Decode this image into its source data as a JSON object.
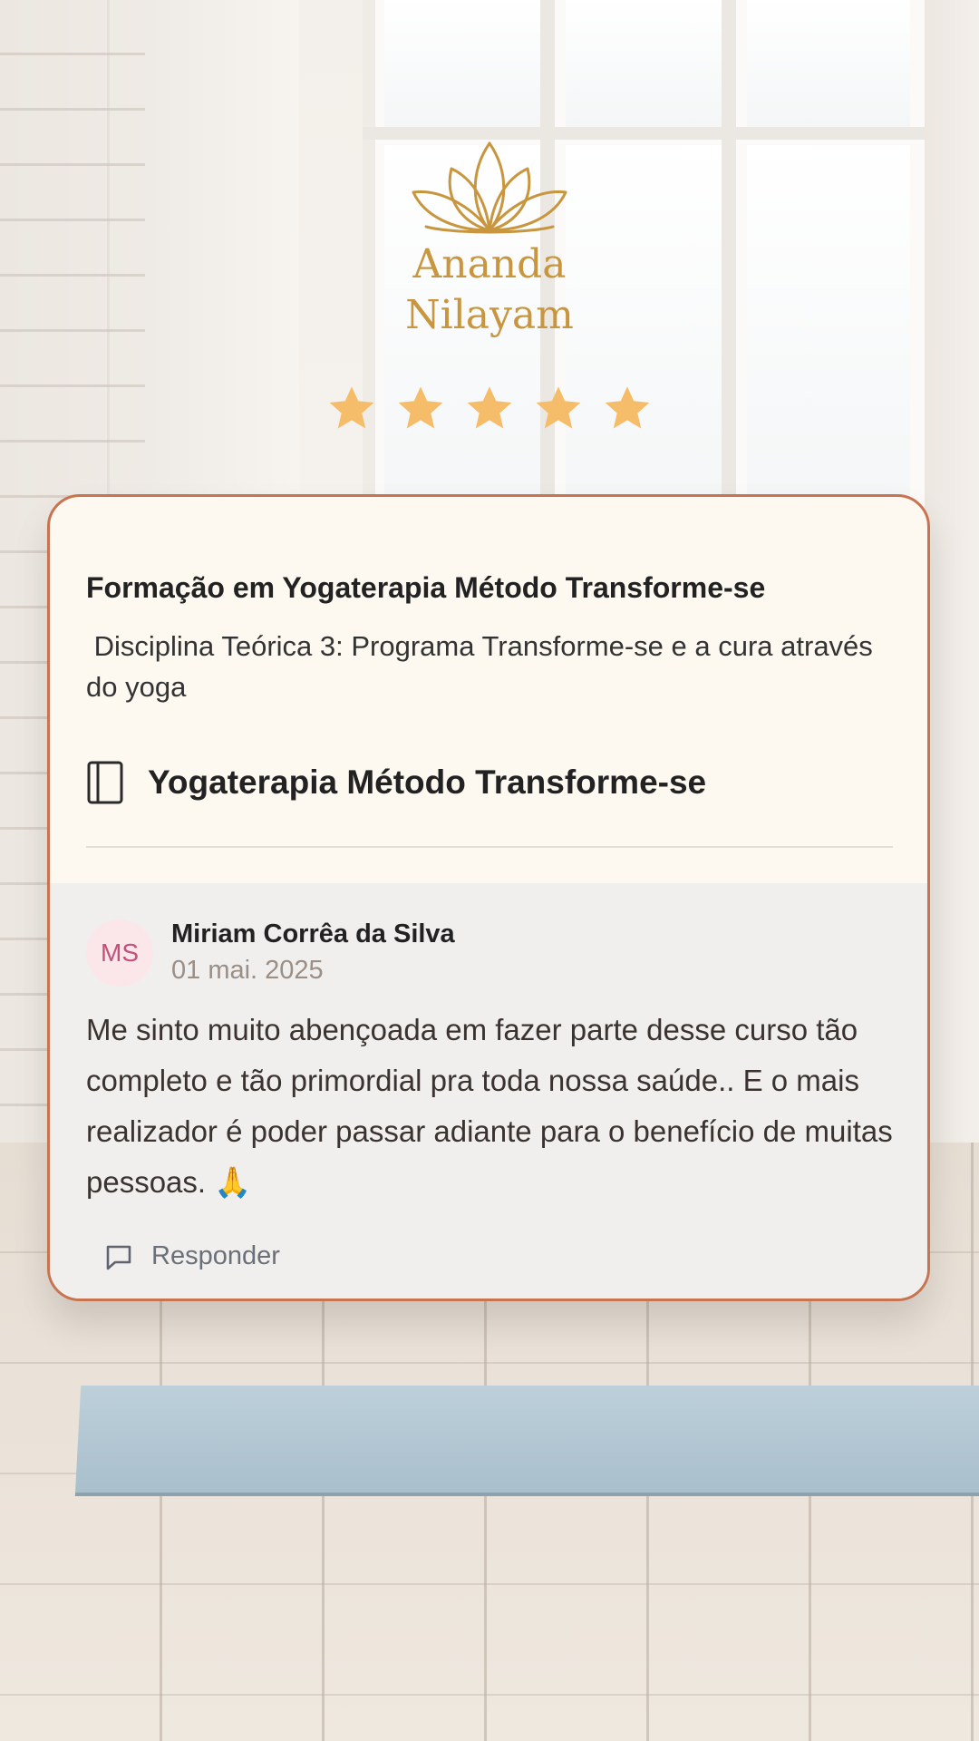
{
  "brand": {
    "line1": "Ananda",
    "line2": "Nilayam",
    "color": "#c8963e"
  },
  "rating": {
    "value": 5,
    "max": 5,
    "star_color": "#f5bd6a"
  },
  "card": {
    "course_title": "Formação em Yogaterapia Método Transforme-se",
    "discipline": " Disciplina Teórica 3: Programa Transforme-se e a cura através do yoga",
    "product": {
      "icon": "book-icon",
      "title": "Yogaterapia Método Transforme-se"
    },
    "border_color": "#c87450"
  },
  "review": {
    "avatar_initials": "MS",
    "author": "Miriam Corrêa da Silva",
    "date": "01 mai. 2025",
    "text": "Me sinto muito abençoada em fazer parte desse curso tão completo e tão primordial pra toda nossa saúde.. E o mais realizador é poder passar adiante para o benefício de muitas pessoas. 🙏",
    "reply_icon": "comment-icon",
    "reply_label": "Responder"
  }
}
